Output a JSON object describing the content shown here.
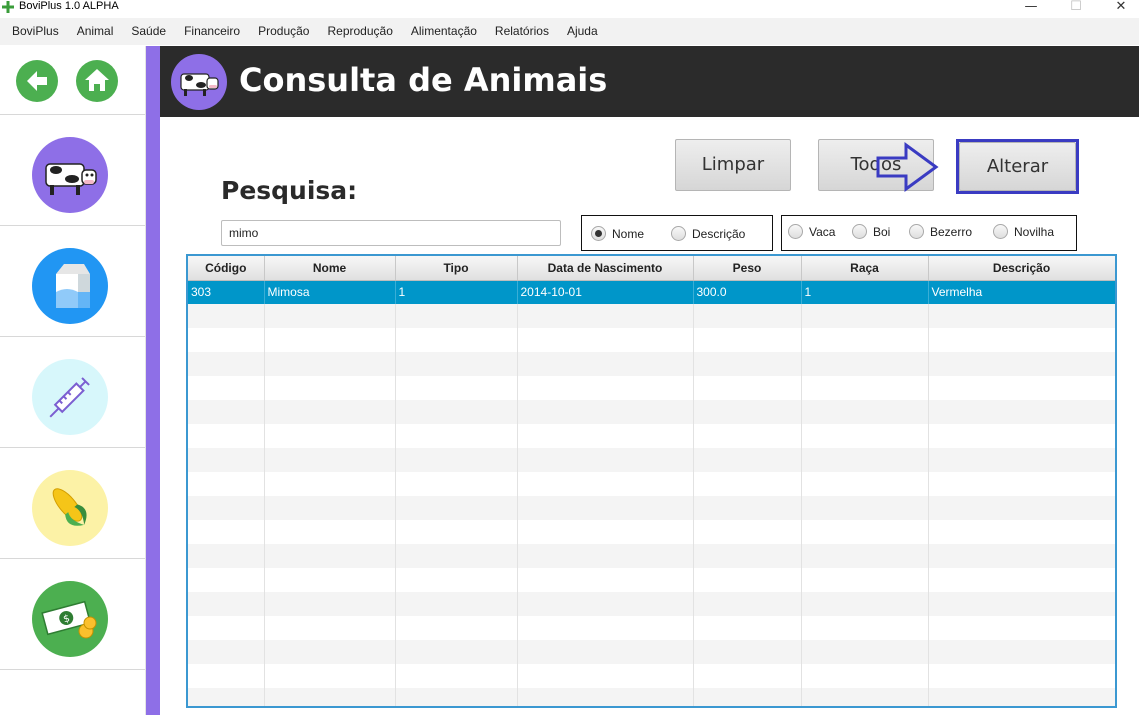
{
  "window": {
    "title": "BoviPlus 1.0 ALPHA",
    "minimize": "—",
    "maximize": "☐",
    "close": "✕"
  },
  "menu": [
    "BoviPlus",
    "Animal",
    "Saúde",
    "Financeiro",
    "Produção",
    "Reprodução",
    "Alimentação",
    "Relatórios",
    "Ajuda"
  ],
  "sidebar": {
    "nav": [
      {
        "icon": "back-arrow-icon"
      },
      {
        "icon": "home-icon"
      }
    ],
    "items": [
      {
        "icon": "cow-icon",
        "color": "#8e6fe7"
      },
      {
        "icon": "milk-carton-icon",
        "color": "#2196f3"
      },
      {
        "icon": "syringe-icon",
        "color": "#d7f7fb"
      },
      {
        "icon": "corn-icon",
        "color": "#fcf2a6"
      },
      {
        "icon": "money-icon",
        "color": "#4caf50"
      }
    ]
  },
  "header": {
    "title": "Consulta de Animais",
    "icon": "cow-icon"
  },
  "buttons": {
    "clear": "Limpar",
    "all": "Todos",
    "edit": "Alterar"
  },
  "search": {
    "label": "Pesquisa:",
    "value": "mimo"
  },
  "search_by": {
    "options": [
      "Nome",
      "Descrição"
    ],
    "selected": "Nome"
  },
  "type_filter": {
    "options": [
      "Vaca",
      "Boi",
      "Bezerro",
      "Novilha"
    ],
    "selected": null
  },
  "table": {
    "columns": [
      "Código",
      "Nome",
      "Tipo",
      "Data de Nascimento",
      "Peso",
      "Raça",
      "Descrição"
    ],
    "rows": [
      [
        "303",
        "Mimosa",
        "1",
        "2014-10-01",
        "300.0",
        "1",
        "Vermelha"
      ]
    ],
    "selected_row": 0
  },
  "colors": {
    "accent": "#8e6fe7",
    "header_bg": "#2b2b2b",
    "selection": "#0096c9",
    "highlight_border": "#3a3bc2"
  }
}
